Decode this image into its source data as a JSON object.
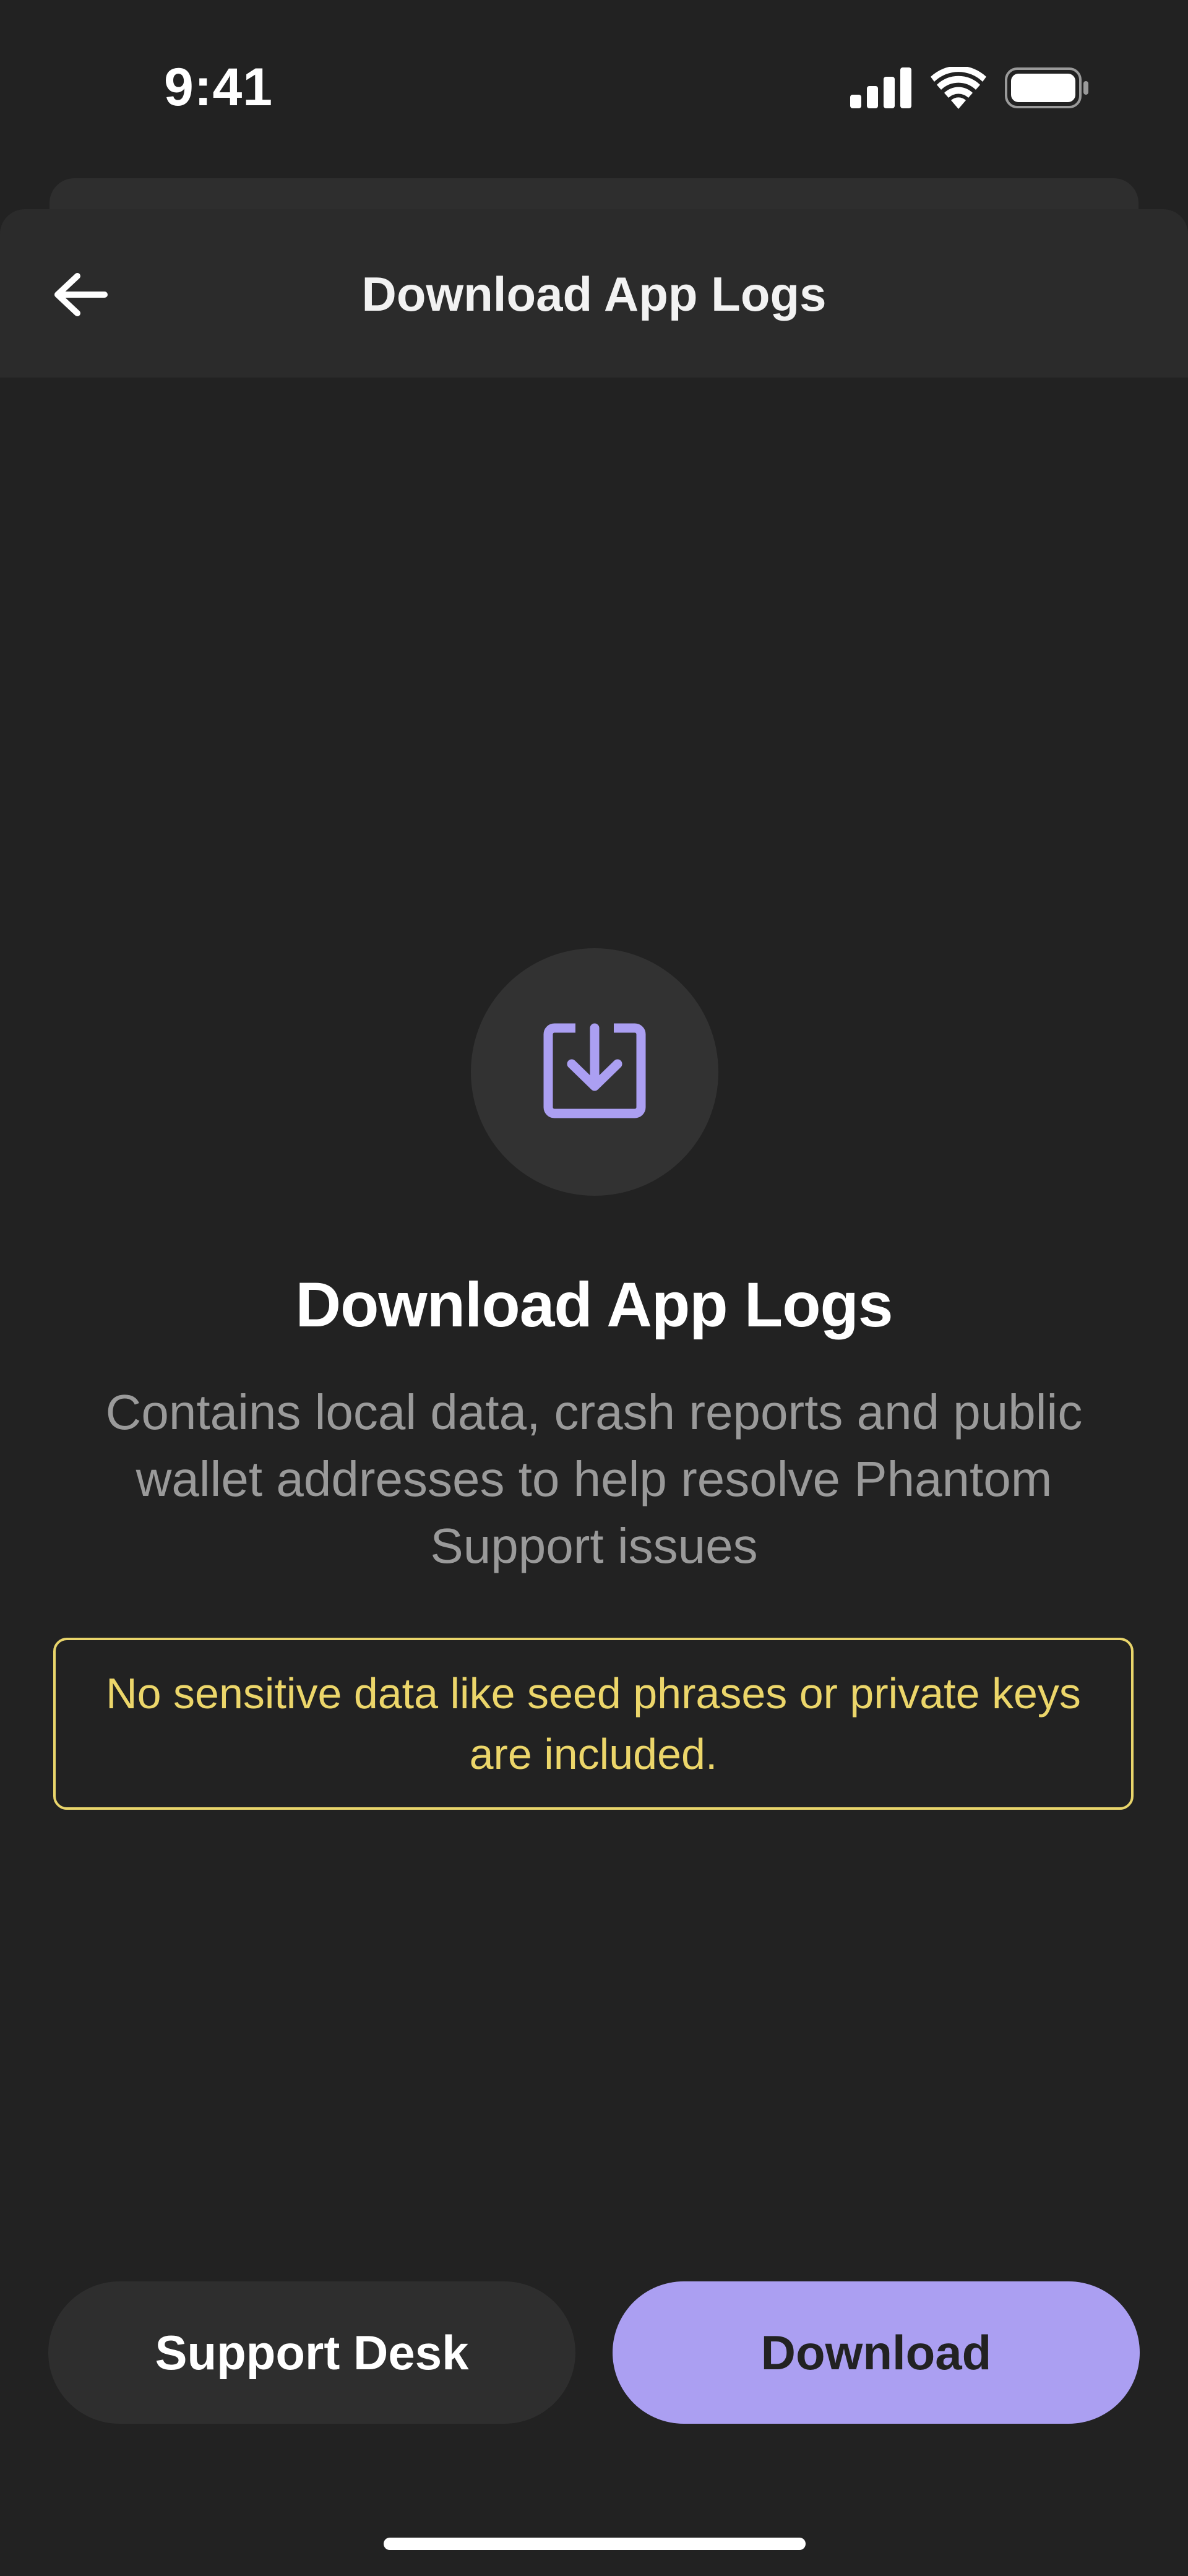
{
  "status_bar": {
    "time": "9:41",
    "icons": [
      "cellular-signal-icon",
      "wifi-icon",
      "battery-icon"
    ]
  },
  "header": {
    "title": "Download App Logs",
    "back_icon": "arrow-left-icon"
  },
  "content": {
    "icon": "download-tray-icon",
    "title": "Download App Logs",
    "description": "Contains local data, crash reports and public wallet addresses to help resolve Phantom Support issues",
    "notice": "No sensitive data like seed phrases or private keys are included."
  },
  "actions": {
    "support_label": "Support Desk",
    "download_label": "Download"
  },
  "colors": {
    "background": "#222222",
    "accent": "#ab9ff2",
    "warning": "#ecd66a"
  }
}
